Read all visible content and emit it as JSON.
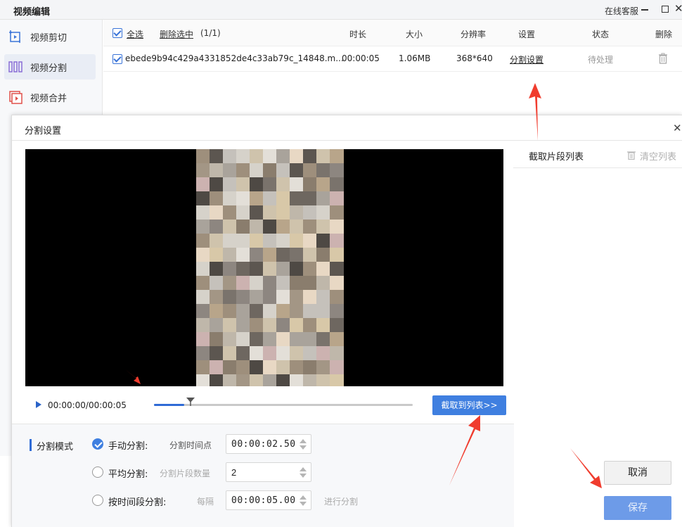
{
  "window": {
    "title": "视频编辑",
    "support": "在线客服"
  },
  "sidebar": {
    "items": [
      {
        "label": "视频剪切",
        "icon": "video-cut-icon"
      },
      {
        "label": "视频分割",
        "icon": "video-split-icon",
        "active": true
      },
      {
        "label": "视频合并",
        "icon": "video-merge-icon"
      }
    ]
  },
  "file_table": {
    "select_all": "全选",
    "delete_selected": "删除选中",
    "count": "(1/1)",
    "columns": [
      "时长",
      "大小",
      "分辨率",
      "设置",
      "状态",
      "删除"
    ],
    "rows": [
      {
        "name": "ebede9b94c429a4331852de4c33ab79c_14848.m...",
        "duration": "00:00:05",
        "size": "1.06MB",
        "resolution": "368*640",
        "settings": "分割设置",
        "status": "待处理"
      }
    ]
  },
  "dialog": {
    "title": "分割设置",
    "time_display": "00:00:00/00:00:05",
    "playback_progress": 0.14,
    "capture_button": "截取到列表>>",
    "clip_list_title": "截取片段列表",
    "clear_list": "清空列表",
    "split_mode_label": "分割模式",
    "options": [
      {
        "label": "手动分割:",
        "field_label": "分割时间点",
        "value": "00:00:02.50",
        "checked": true
      },
      {
        "label": "平均分割:",
        "field_label": "分割片段数量",
        "value": "2",
        "checked": false
      },
      {
        "label": "按时间段分割:",
        "field_label": "每隔",
        "value": "00:00:05.00",
        "suffix": "进行分割",
        "checked": false
      }
    ],
    "cancel": "取消",
    "save": "保存"
  },
  "colors": {
    "accent": "#3f7fe0",
    "annotation": "#f03c2e"
  }
}
